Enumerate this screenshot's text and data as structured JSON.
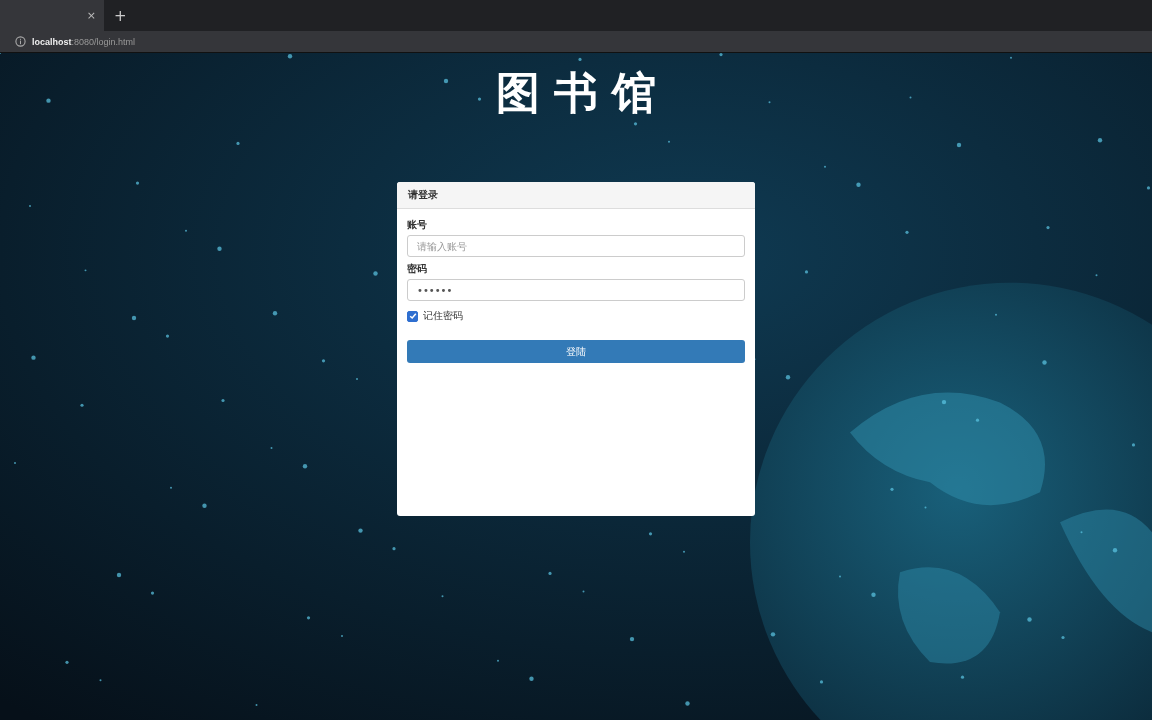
{
  "browser": {
    "tab_close": "×",
    "new_tab": "+",
    "address": {
      "host": "localhost",
      "path": ":8080/login.html"
    }
  },
  "page": {
    "title": "图书馆"
  },
  "login_panel": {
    "heading": "请登录",
    "fields": [
      {
        "label": "账号",
        "placeholder": "请输入账号"
      },
      {
        "label": "密码",
        "value": "••••••"
      }
    ],
    "remember": {
      "label": "记住密码",
      "checked": true
    },
    "submit": "登陆"
  }
}
